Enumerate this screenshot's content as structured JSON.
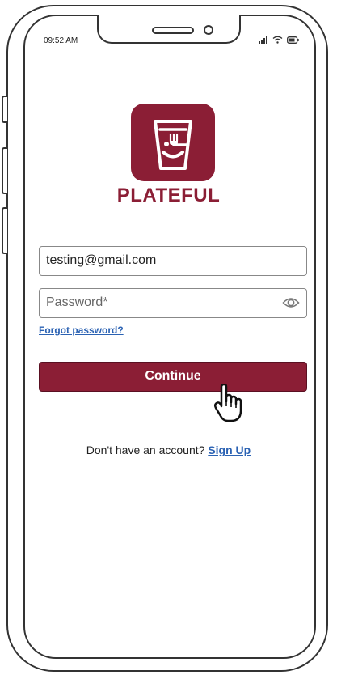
{
  "status_bar": {
    "time": "09:52 AM",
    "icons": [
      "signal-icon",
      "wifi-icon",
      "battery-icon"
    ]
  },
  "brand": {
    "name": "PLATEFUL",
    "color": "#8b1e35",
    "logo_icon": "plateful-cup-icon"
  },
  "login_form": {
    "email_value": "testing@gmail.com",
    "email_placeholder": "",
    "password_value": "",
    "password_placeholder": "Password*",
    "password_toggle_icon": "eye-icon",
    "forgot_password_label": "Forgot password?",
    "continue_label": "Continue"
  },
  "signup": {
    "prompt": "Don't have an account?",
    "link_label": "Sign Up",
    "link_color": "#2b62b3"
  },
  "cursor_icon": "hand-pointer-icon"
}
